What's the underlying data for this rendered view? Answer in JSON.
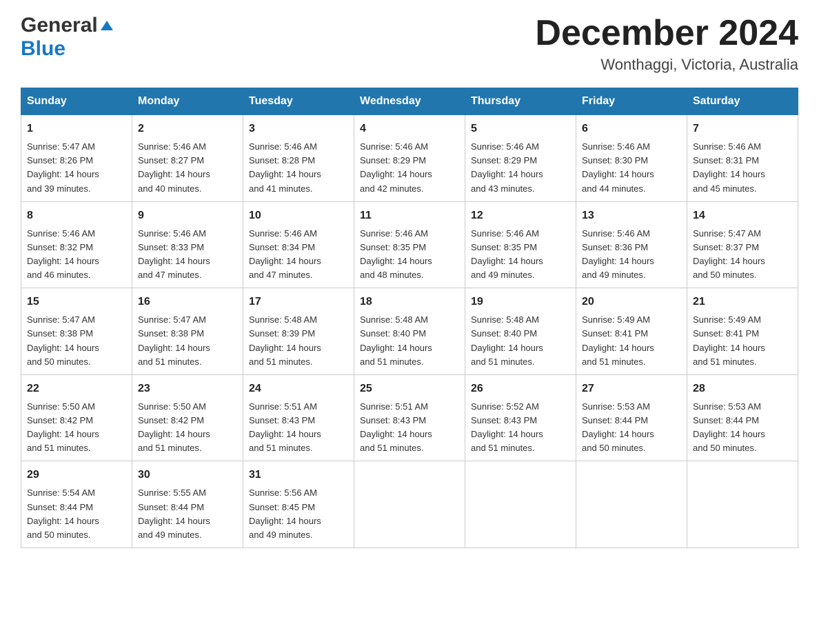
{
  "header": {
    "logo_general": "General",
    "logo_blue": "Blue",
    "month_title": "December 2024",
    "location": "Wonthaggi, Victoria, Australia"
  },
  "days_of_week": [
    "Sunday",
    "Monday",
    "Tuesday",
    "Wednesday",
    "Thursday",
    "Friday",
    "Saturday"
  ],
  "weeks": [
    [
      {
        "day": "1",
        "sunrise": "5:47 AM",
        "sunset": "8:26 PM",
        "daylight": "14 hours and 39 minutes."
      },
      {
        "day": "2",
        "sunrise": "5:46 AM",
        "sunset": "8:27 PM",
        "daylight": "14 hours and 40 minutes."
      },
      {
        "day": "3",
        "sunrise": "5:46 AM",
        "sunset": "8:28 PM",
        "daylight": "14 hours and 41 minutes."
      },
      {
        "day": "4",
        "sunrise": "5:46 AM",
        "sunset": "8:29 PM",
        "daylight": "14 hours and 42 minutes."
      },
      {
        "day": "5",
        "sunrise": "5:46 AM",
        "sunset": "8:29 PM",
        "daylight": "14 hours and 43 minutes."
      },
      {
        "day": "6",
        "sunrise": "5:46 AM",
        "sunset": "8:30 PM",
        "daylight": "14 hours and 44 minutes."
      },
      {
        "day": "7",
        "sunrise": "5:46 AM",
        "sunset": "8:31 PM",
        "daylight": "14 hours and 45 minutes."
      }
    ],
    [
      {
        "day": "8",
        "sunrise": "5:46 AM",
        "sunset": "8:32 PM",
        "daylight": "14 hours and 46 minutes."
      },
      {
        "day": "9",
        "sunrise": "5:46 AM",
        "sunset": "8:33 PM",
        "daylight": "14 hours and 47 minutes."
      },
      {
        "day": "10",
        "sunrise": "5:46 AM",
        "sunset": "8:34 PM",
        "daylight": "14 hours and 47 minutes."
      },
      {
        "day": "11",
        "sunrise": "5:46 AM",
        "sunset": "8:35 PM",
        "daylight": "14 hours and 48 minutes."
      },
      {
        "day": "12",
        "sunrise": "5:46 AM",
        "sunset": "8:35 PM",
        "daylight": "14 hours and 49 minutes."
      },
      {
        "day": "13",
        "sunrise": "5:46 AM",
        "sunset": "8:36 PM",
        "daylight": "14 hours and 49 minutes."
      },
      {
        "day": "14",
        "sunrise": "5:47 AM",
        "sunset": "8:37 PM",
        "daylight": "14 hours and 50 minutes."
      }
    ],
    [
      {
        "day": "15",
        "sunrise": "5:47 AM",
        "sunset": "8:38 PM",
        "daylight": "14 hours and 50 minutes."
      },
      {
        "day": "16",
        "sunrise": "5:47 AM",
        "sunset": "8:38 PM",
        "daylight": "14 hours and 51 minutes."
      },
      {
        "day": "17",
        "sunrise": "5:48 AM",
        "sunset": "8:39 PM",
        "daylight": "14 hours and 51 minutes."
      },
      {
        "day": "18",
        "sunrise": "5:48 AM",
        "sunset": "8:40 PM",
        "daylight": "14 hours and 51 minutes."
      },
      {
        "day": "19",
        "sunrise": "5:48 AM",
        "sunset": "8:40 PM",
        "daylight": "14 hours and 51 minutes."
      },
      {
        "day": "20",
        "sunrise": "5:49 AM",
        "sunset": "8:41 PM",
        "daylight": "14 hours and 51 minutes."
      },
      {
        "day": "21",
        "sunrise": "5:49 AM",
        "sunset": "8:41 PM",
        "daylight": "14 hours and 51 minutes."
      }
    ],
    [
      {
        "day": "22",
        "sunrise": "5:50 AM",
        "sunset": "8:42 PM",
        "daylight": "14 hours and 51 minutes."
      },
      {
        "day": "23",
        "sunrise": "5:50 AM",
        "sunset": "8:42 PM",
        "daylight": "14 hours and 51 minutes."
      },
      {
        "day": "24",
        "sunrise": "5:51 AM",
        "sunset": "8:43 PM",
        "daylight": "14 hours and 51 minutes."
      },
      {
        "day": "25",
        "sunrise": "5:51 AM",
        "sunset": "8:43 PM",
        "daylight": "14 hours and 51 minutes."
      },
      {
        "day": "26",
        "sunrise": "5:52 AM",
        "sunset": "8:43 PM",
        "daylight": "14 hours and 51 minutes."
      },
      {
        "day": "27",
        "sunrise": "5:53 AM",
        "sunset": "8:44 PM",
        "daylight": "14 hours and 50 minutes."
      },
      {
        "day": "28",
        "sunrise": "5:53 AM",
        "sunset": "8:44 PM",
        "daylight": "14 hours and 50 minutes."
      }
    ],
    [
      {
        "day": "29",
        "sunrise": "5:54 AM",
        "sunset": "8:44 PM",
        "daylight": "14 hours and 50 minutes."
      },
      {
        "day": "30",
        "sunrise": "5:55 AM",
        "sunset": "8:44 PM",
        "daylight": "14 hours and 49 minutes."
      },
      {
        "day": "31",
        "sunrise": "5:56 AM",
        "sunset": "8:45 PM",
        "daylight": "14 hours and 49 minutes."
      },
      null,
      null,
      null,
      null
    ]
  ],
  "labels": {
    "sunrise": "Sunrise:",
    "sunset": "Sunset:",
    "daylight": "Daylight:"
  }
}
